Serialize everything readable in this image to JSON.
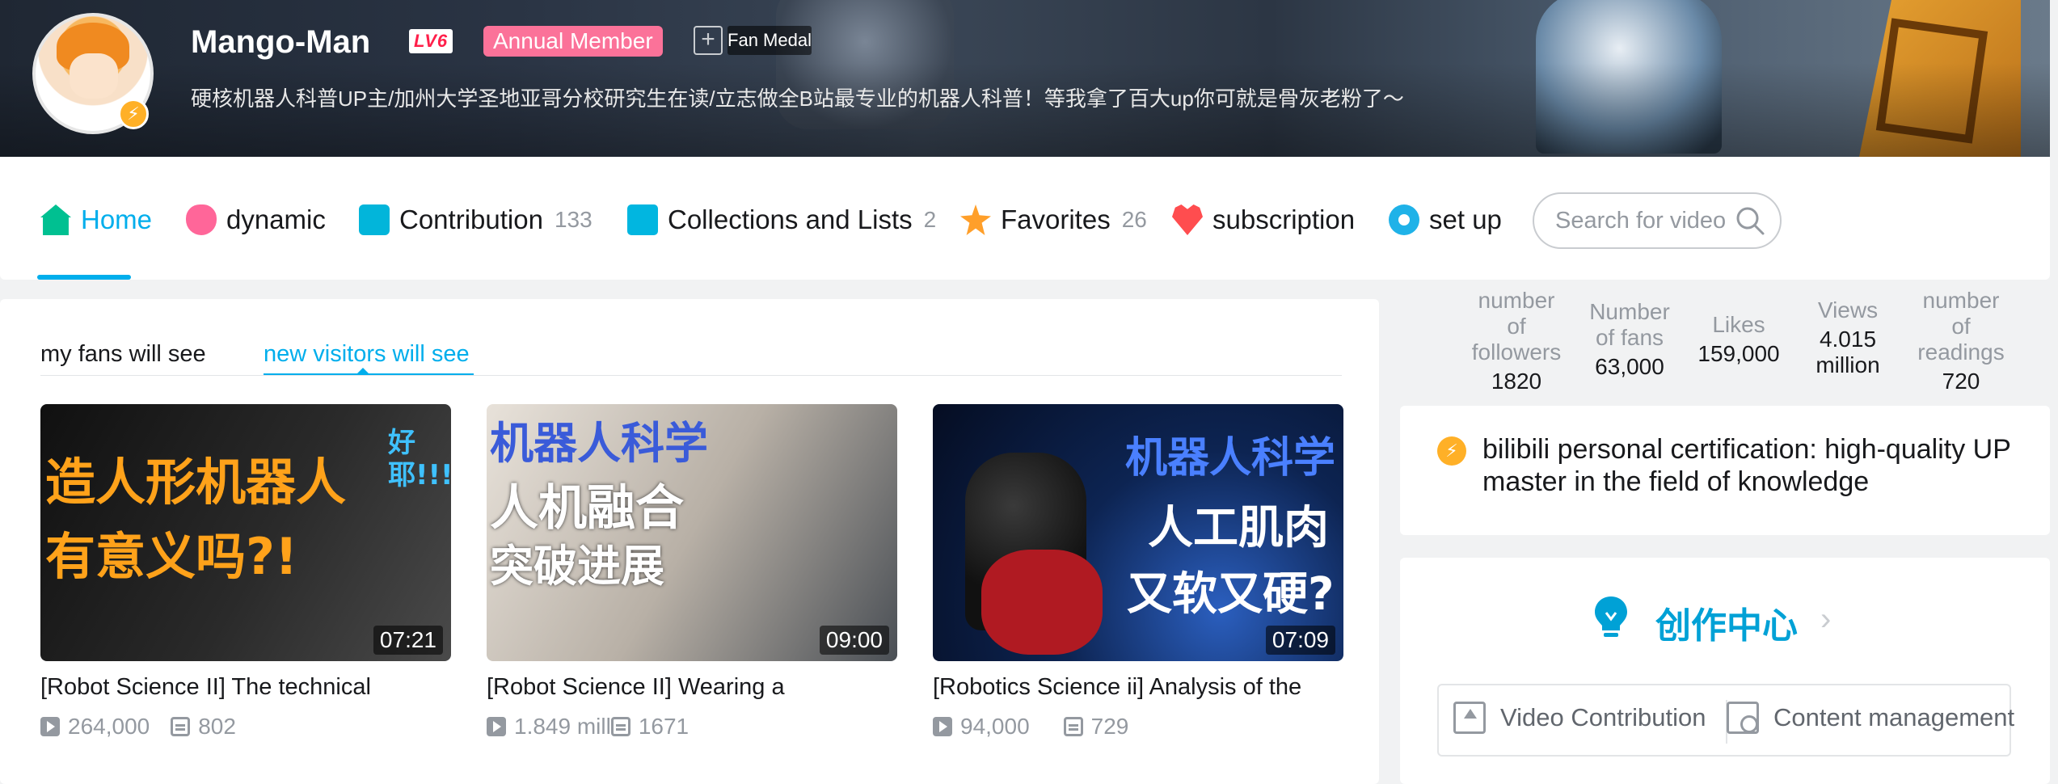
{
  "profile": {
    "username": "Mango-Man",
    "level": "LV6",
    "member_badge": "Annual Member",
    "fan_medal_plus": "+",
    "fan_medal_label": "Fan Medal",
    "signature": "硬核机器人科普UP主/加州大学圣地亚哥分校研究生在读/立志做全B站最专业的机器人科普！等我拿了百大up你可就是骨灰老粉了～",
    "avatar_badge": "⚡"
  },
  "nav": {
    "items": [
      {
        "label": "Home",
        "icon": "home-icon",
        "count": ""
      },
      {
        "label": "dynamic",
        "icon": "dynamic-icon",
        "count": ""
      },
      {
        "label": "Contribution",
        "icon": "contribution-icon",
        "count": "133"
      },
      {
        "label": "Collections and Lists",
        "icon": "collections-icon",
        "count": "2"
      },
      {
        "label": "Favorites",
        "icon": "star-icon",
        "count": "26"
      },
      {
        "label": "subscription",
        "icon": "heart-icon",
        "count": ""
      },
      {
        "label": "set up",
        "icon": "gear-icon",
        "count": ""
      }
    ],
    "search_placeholder": "Search for video"
  },
  "stats": [
    {
      "label": "number of followers",
      "value": "1820"
    },
    {
      "label": "Number of fans",
      "value": "63,000"
    },
    {
      "label": "Likes",
      "value": "159,000"
    },
    {
      "label": "Views",
      "value": "4.015 million"
    },
    {
      "label": "number of readings",
      "value": "720"
    }
  ],
  "visibility_tabs": {
    "fans": "my fans will see",
    "new_visitors": "new visitors will see"
  },
  "videos": [
    {
      "thumb_lines": [
        "造人形机器人",
        "有意义吗?!",
        "好耶!!!"
      ],
      "duration": "07:21",
      "title": "[Robot Science II] The technical",
      "views": "264,000",
      "danmaku": "802"
    },
    {
      "thumb_lines": [
        "机器人科学",
        "人机融合",
        "突破进展"
      ],
      "duration": "09:00",
      "title": "[Robot Science II] Wearing a",
      "views": "1.849 mill",
      "danmaku": "1671"
    },
    {
      "thumb_lines": [
        "机器人科学",
        "人工肌肉",
        "又软又硬?"
      ],
      "duration": "07:09",
      "title": "[Robotics Science ii] Analysis of the",
      "views": "94,000",
      "danmaku": "729"
    }
  ],
  "certification": {
    "text": "bilibili personal certification: high-quality UP master in the field of knowledge"
  },
  "creation_center": {
    "title": "创作中心",
    "chevron": "›",
    "video_contribution": "Video Contribution",
    "content_management": "Content management"
  },
  "colors": {
    "accent": "#00aeec",
    "member_pink": "#fb7299",
    "level_red": "#ff1f4a",
    "cert_gold": "#ffb027"
  }
}
